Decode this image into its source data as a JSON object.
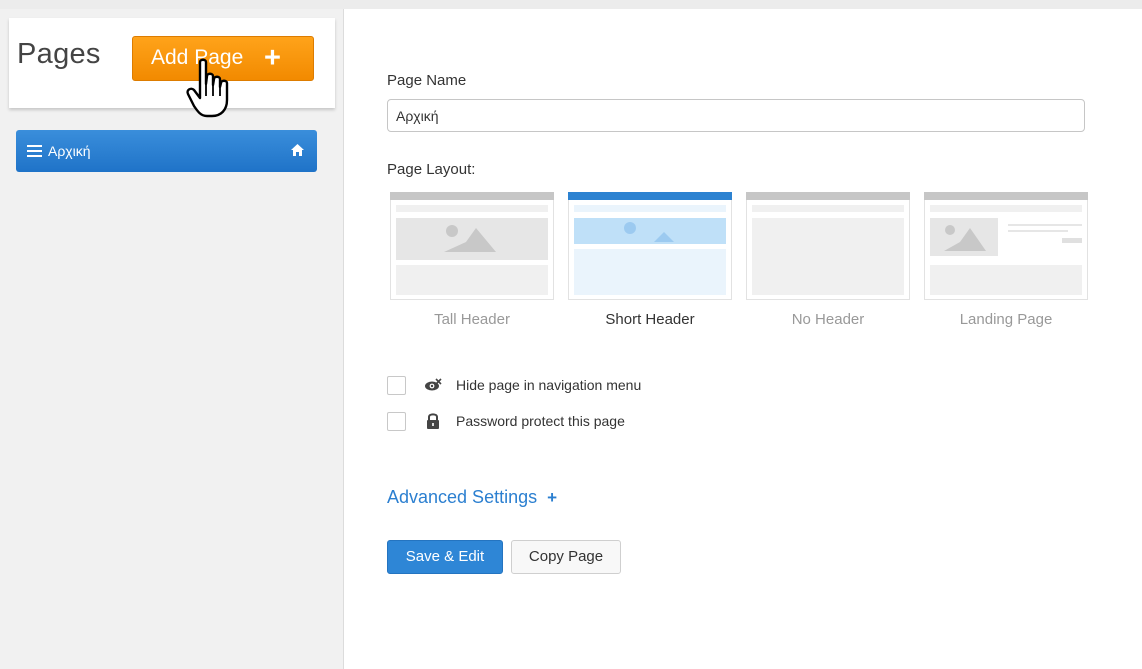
{
  "sidebar": {
    "title": "Pages",
    "add_button": {
      "label": "Add Page",
      "icon": "+"
    },
    "items": [
      {
        "label": "Αρχική",
        "icon": "home-icon"
      }
    ]
  },
  "form": {
    "page_name_label": "Page Name",
    "page_name_value": "Αρχική",
    "layout_label": "Page Layout:",
    "layouts": [
      {
        "label": "Tall Header",
        "selected": false
      },
      {
        "label": "Short Header",
        "selected": true
      },
      {
        "label": "No Header",
        "selected": false
      },
      {
        "label": "Landing Page",
        "selected": false
      }
    ],
    "options": [
      {
        "label": "Hide page in navigation menu",
        "icon": "eye-slash-icon",
        "checked": false
      },
      {
        "label": "Password protect this page",
        "icon": "lock-icon",
        "checked": false
      }
    ],
    "advanced_label": "Advanced Settings",
    "advanced_icon": "+",
    "save_label": "Save & Edit",
    "copy_label": "Copy Page"
  },
  "colors": {
    "accent_orange": "#f7941d",
    "primary_blue": "#2e86d6",
    "link_blue": "#2b7fd0"
  }
}
